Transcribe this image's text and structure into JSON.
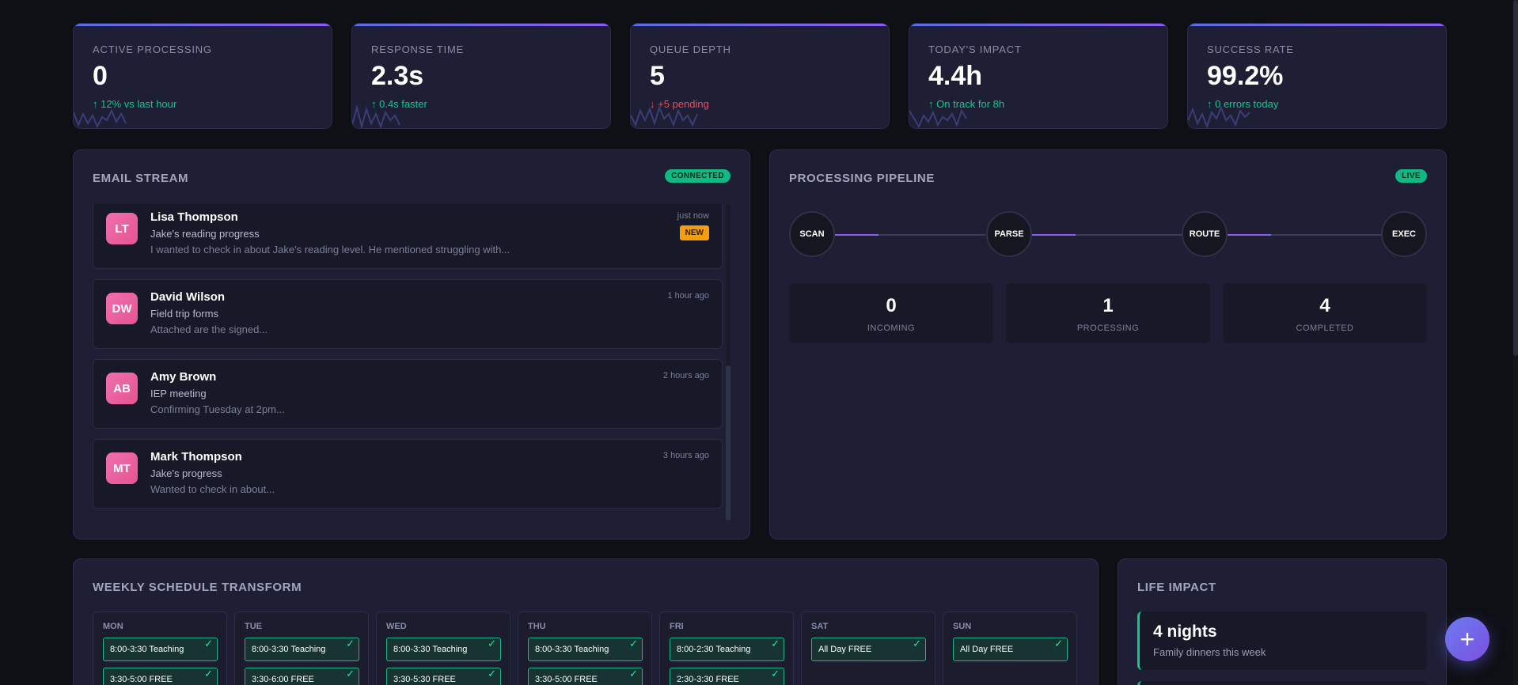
{
  "stats": [
    {
      "label": "ACTIVE PROCESSING",
      "value": "0",
      "delta": "↑ 12% vs last hour",
      "trend": "up"
    },
    {
      "label": "RESPONSE TIME",
      "value": "2.3s",
      "delta": "↑ 0.4s faster",
      "trend": "up"
    },
    {
      "label": "QUEUE DEPTH",
      "value": "5",
      "delta": "↓ +5 pending",
      "trend": "down"
    },
    {
      "label": "TODAY'S IMPACT",
      "value": "4.4h",
      "delta": "↑ On track for 8h",
      "trend": "up"
    },
    {
      "label": "SUCCESS RATE",
      "value": "99.2%",
      "delta": "↑ 0 errors today",
      "trend": "up"
    }
  ],
  "email_stream": {
    "title": "EMAIL STREAM",
    "status": "CONNECTED",
    "emails": [
      {
        "initials": "LT",
        "sender": "Lisa Thompson",
        "subject": "Jake's reading progress",
        "preview": "I wanted to check in about Jake's reading level. He mentioned struggling with...",
        "time": "just now",
        "tag": "NEW"
      },
      {
        "initials": "DW",
        "sender": "David Wilson",
        "subject": "Field trip forms",
        "preview": "Attached are the signed...",
        "time": "1 hour ago"
      },
      {
        "initials": "AB",
        "sender": "Amy Brown",
        "subject": "IEP meeting",
        "preview": "Confirming Tuesday at 2pm...",
        "time": "2 hours ago"
      },
      {
        "initials": "MT",
        "sender": "Mark Thompson",
        "subject": "Jake's progress",
        "preview": "Wanted to check in about...",
        "time": "3 hours ago"
      }
    ]
  },
  "pipeline": {
    "title": "PROCESSING PIPELINE",
    "status": "LIVE",
    "stages": [
      "SCAN",
      "PARSE",
      "ROUTE",
      "EXEC"
    ],
    "counts": [
      {
        "value": "0",
        "label": "INCOMING"
      },
      {
        "value": "1",
        "label": "PROCESSING"
      },
      {
        "value": "4",
        "label": "COMPLETED"
      }
    ]
  },
  "schedule": {
    "title": "WEEKLY SCHEDULE TRANSFORM",
    "days": [
      {
        "name": "MON",
        "slots": [
          "8:00-3:30 Teaching",
          "3:30-5:00 FREE"
        ]
      },
      {
        "name": "TUE",
        "slots": [
          "8:00-3:30 Teaching",
          "3:30-6:00 FREE"
        ]
      },
      {
        "name": "WED",
        "slots": [
          "8:00-3:30 Teaching",
          "3:30-5:30 FREE"
        ]
      },
      {
        "name": "THU",
        "slots": [
          "8:00-3:30 Teaching",
          "3:30-5:00 FREE"
        ]
      },
      {
        "name": "FRI",
        "slots": [
          "8:00-2:30 Teaching",
          "2:30-3:30 FREE"
        ]
      },
      {
        "name": "SAT",
        "slots": [
          "All Day FREE"
        ]
      },
      {
        "name": "SUN",
        "slots": [
          "All Day FREE"
        ]
      }
    ]
  },
  "life_impact": {
    "title": "LIFE IMPACT",
    "cards": [
      {
        "big": "4 nights",
        "small": "Family dinners this week"
      }
    ]
  },
  "fab": {
    "icon": "plus-icon",
    "label": "+"
  },
  "colors": {
    "accent": "#8b5cf6",
    "success": "#10c98f",
    "danger": "#ef4b5a",
    "warning": "#f59e0b",
    "panel": "#1e1f35"
  }
}
